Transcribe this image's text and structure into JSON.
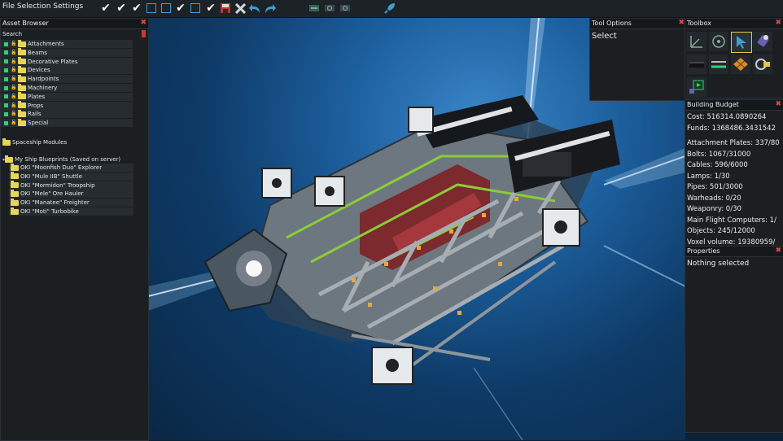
{
  "menu": {
    "file_selection_settings": "File Selection Settings"
  },
  "toolbar": {
    "icons": [
      "check",
      "check",
      "check",
      "empty-box",
      "empty-box",
      "check",
      "empty-box",
      "check",
      "save",
      "delete",
      "undo",
      "redo",
      "view-1",
      "view-2",
      "view-3",
      "launch"
    ]
  },
  "asset_browser": {
    "title": "Asset Browser",
    "search_label": "Search",
    "categories": [
      "Attachments",
      "Beams",
      "Decorative Plates",
      "Devices",
      "Hardpoints",
      "Machinery",
      "Plates",
      "Props",
      "Rails",
      "Special"
    ],
    "selected_category": "Devices",
    "spaceship_modules": "Spaceship Modules",
    "blueprints_folder": "My Ship Blueprints (Saved on server)",
    "blueprints": [
      "OKI \"Moonfish Duo\" Explorer",
      "OKI \"Mule IIB\" Shuttle",
      "OKI \"Mormidon\" Troopship",
      "OKI \"Mele\" Ore Hauler",
      "OKI \"Manatee\" Freighter",
      "OKI \"Moti\" Turbobike"
    ],
    "selected_blueprint": "OKI \"Mele\" Ore Hauler"
  },
  "tool_options": {
    "title": "Tool Options",
    "value": "Select"
  },
  "toolbox": {
    "title": "Toolbox",
    "tools": [
      "axes-tool",
      "rotate-tool",
      "select-tool",
      "paint-tool",
      "plate-tool",
      "wire-tool",
      "grid-tool",
      "link-tool",
      "simulate-tool"
    ],
    "active_tool": "select-tool"
  },
  "building_budget": {
    "title": "Building Budget",
    "cost": "Cost: 516314.0890264",
    "funds": "Funds: 1368486.3431542",
    "lines": [
      "Attachment Plates: 337/80",
      "Bolts: 1067/31000",
      "Cables: 596/6000",
      "Lamps: 1/30",
      "Pipes: 501/3000",
      "Warheads: 0/20",
      "Weaponry: 0/30",
      "Main Flight Computers: 1/",
      "Objects: 245/12000",
      "Voxel volume: 19380959/"
    ]
  },
  "properties": {
    "title": "Properties",
    "value": "Nothing selected"
  },
  "colors": {
    "accent_blue": "#3aa0d8",
    "close_red": "#e04848",
    "highlight_yellow": "#e8c640",
    "status_green": "#2fd17a"
  }
}
